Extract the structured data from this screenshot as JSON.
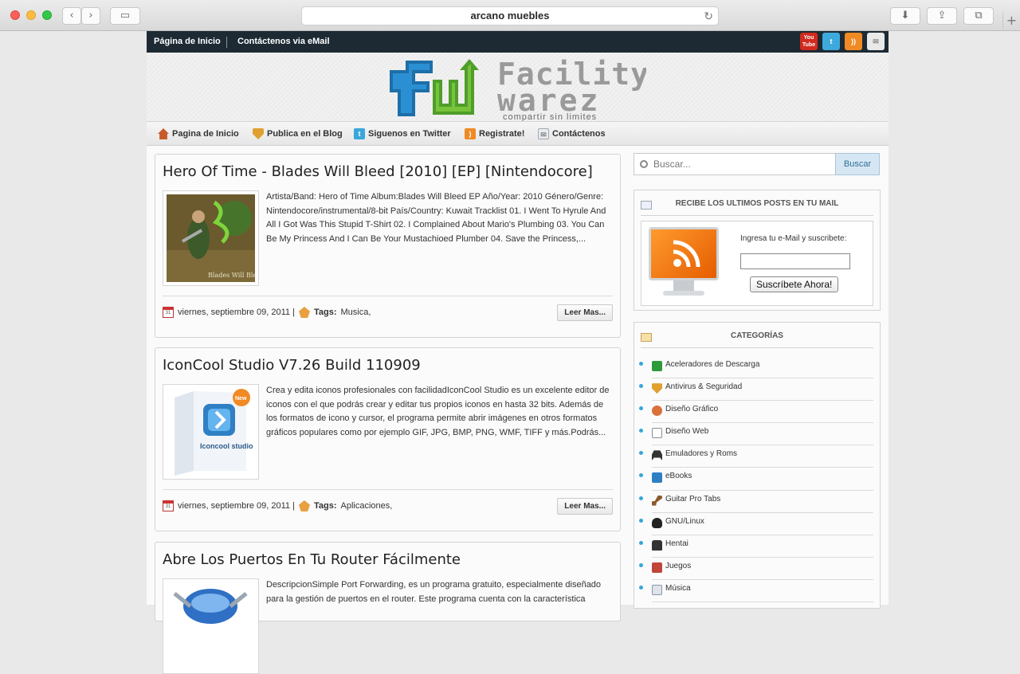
{
  "browser": {
    "address": "arcano muebles"
  },
  "topbar": {
    "links": [
      "Página de Inicio",
      "Contáctenos via eMail"
    ],
    "social": [
      "YouTube",
      "Twitter",
      "RSS",
      "eMail"
    ],
    "youtube_label": "You Tube"
  },
  "banner": {
    "logo_line1": "Facility",
    "logo_line2": "warez",
    "logo_tagline": "compartir sin limites"
  },
  "nav": [
    {
      "label": "Pagina de Inicio",
      "icon": "home-icon",
      "color": "#c85a2a"
    },
    {
      "label": "Publica en el Blog",
      "icon": "shield-icon",
      "color": "#e0a030"
    },
    {
      "label": "Siguenos en Twitter",
      "icon": "twitter-icon",
      "color": "#3aa7db"
    },
    {
      "label": "Registrate!",
      "icon": "rss-icon",
      "color": "#f08a24"
    },
    {
      "label": "Contáctenos",
      "icon": "mail-icon",
      "color": "#a0a8b0"
    }
  ],
  "posts": [
    {
      "title": "Hero Of Time - Blades Will Bleed [2010] [EP] [Nintendocore]",
      "excerpt": "Artista/Band: Hero of Time Album:Blades Will Bleed EP Año/Year: 2010 Género/Genre: Nintendocore/instrumental/8-bit País/Country: Kuwait Tracklist 01. I Went To Hyrule And All I Got Was This Stupid T-Shirt 02. I Complained About Mario's Plumbing 03. You Can Be My Princess And I Can Be Your Mustachioed Plumber 04. Save the Princess,...",
      "date": "viernes, septiembre 09, 2011 |",
      "tags_label": "Tags:",
      "tags": "Musica,",
      "read_more": "Leer Mas...",
      "thumb_caption": "Blades Will Bleed"
    },
    {
      "title": "IconCool Studio V7.26 Build 110909",
      "excerpt": "Crea y edita iconos profesionales con facilidadIconCool Studio es un excelente editor de iconos con el que podrás crear y editar tus propios iconos en hasta 32 bits. Además de los formatos de icono y cursor, el programa permite abrir imágenes en otros formatos gráficos populares como por ejemplo GIF, JPG, BMP, PNG, WMF, TIFF y más.Podrás...",
      "date": "viernes, septiembre 09, 2011 |",
      "tags_label": "Tags:",
      "tags": "Aplicaciones,",
      "read_more": "Leer Mas...",
      "thumb_caption": "Iconcool studio",
      "thumb_badge": "New"
    },
    {
      "title": "Abre Los Puertos En Tu Router Fácilmente",
      "excerpt": "DescripcionSimple Port Forwarding, es un programa gratuito, especialmente diseñado para la gestión de puertos en el router. Este programa cuenta con la característica"
    }
  ],
  "sidebar": {
    "search_placeholder": "Buscar...",
    "search_button": "Buscar",
    "newsletter": {
      "title": "RECIBE LOS ULTIMOS POSTS EN TU MAIL",
      "label": "Ingresa tu e-Mail y suscribete:",
      "button": "Suscríbete Ahora!"
    },
    "categories_title": "CATEGORÍAS",
    "categories": [
      {
        "label": "Aceleradores de Descarga",
        "icon": "download-icon",
        "color": "#2e9a3a"
      },
      {
        "label": "Antivirus & Seguridad",
        "icon": "shield-icon",
        "color": "#e0a030"
      },
      {
        "label": "Diseño Gráfico",
        "icon": "palette-icon",
        "color": "#d9713a"
      },
      {
        "label": "Diseño Web",
        "icon": "web-design-icon",
        "color": "#8a8f96"
      },
      {
        "label": "Emuladores y Roms",
        "icon": "invader-icon",
        "color": "#333333"
      },
      {
        "label": "eBooks",
        "icon": "book-icon",
        "color": "#2f7fc4"
      },
      {
        "label": "Guitar Pro Tabs",
        "icon": "guitar-icon",
        "color": "#8a5a2e"
      },
      {
        "label": "GNU/Linux",
        "icon": "penguin-icon",
        "color": "#222222"
      },
      {
        "label": "Hentai",
        "icon": "lock-icon",
        "color": "#333333"
      },
      {
        "label": "Juegos",
        "icon": "games-icon",
        "color": "#c0453a"
      },
      {
        "label": "Música",
        "icon": "music-icon",
        "color": "#8a96a8"
      }
    ]
  }
}
